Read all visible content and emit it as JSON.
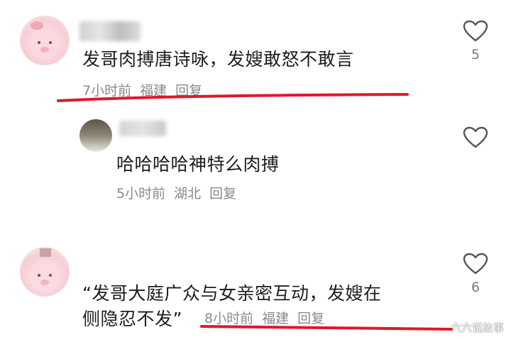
{
  "comments": [
    {
      "text": "发哥肉搏唐诗咏，发嫂敢怒不敢言",
      "time": "7小时前",
      "location": "福建",
      "reply": "回复",
      "likes": "5"
    },
    {
      "text": "哈哈哈哈神特么肉搏",
      "time": "5小时前",
      "location": "湖北",
      "reply": "回复"
    },
    {
      "text_line1": "“发哥大庭广众与女亲密互动，发嫂在",
      "text_line2": "侧隐忍不发”",
      "time": "8小时前",
      "location": "福建",
      "reply": "回复",
      "likes": "6"
    }
  ],
  "watermark": "六六说故事",
  "colors": {
    "underline": "#e0182d",
    "heart": "#555555",
    "meta": "#8a8a8a"
  },
  "icons": [
    "heart-outline-icon"
  ]
}
